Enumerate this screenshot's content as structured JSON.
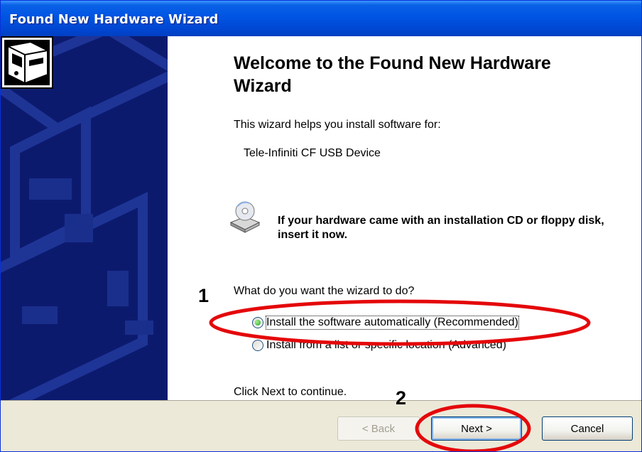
{
  "window": {
    "title": "Found New Hardware Wizard"
  },
  "content": {
    "heading": "Welcome to the Found New Hardware Wizard",
    "intro": "This wizard helps you install software for:",
    "device_name": "Tele-Infiniti CF USB Device",
    "cd_prompt": "If your hardware came with an installation CD or floppy disk, insert it now.",
    "question": "What do you want the wizard to do?",
    "options": [
      {
        "label": "Install the software automatically (Recommended)",
        "checked": true
      },
      {
        "label": "Install from a list or specific location (Advanced)",
        "checked": false
      }
    ],
    "continue_hint": "Click Next to continue."
  },
  "buttons": {
    "back": "< Back",
    "next": "Next >",
    "cancel": "Cancel"
  },
  "annotations": {
    "step1": "1",
    "step2": "2",
    "color": "#e4080a"
  },
  "colors": {
    "title_bar": "#0054e3",
    "side_panel": "#0c1a6e",
    "footer": "#ece9d8"
  }
}
